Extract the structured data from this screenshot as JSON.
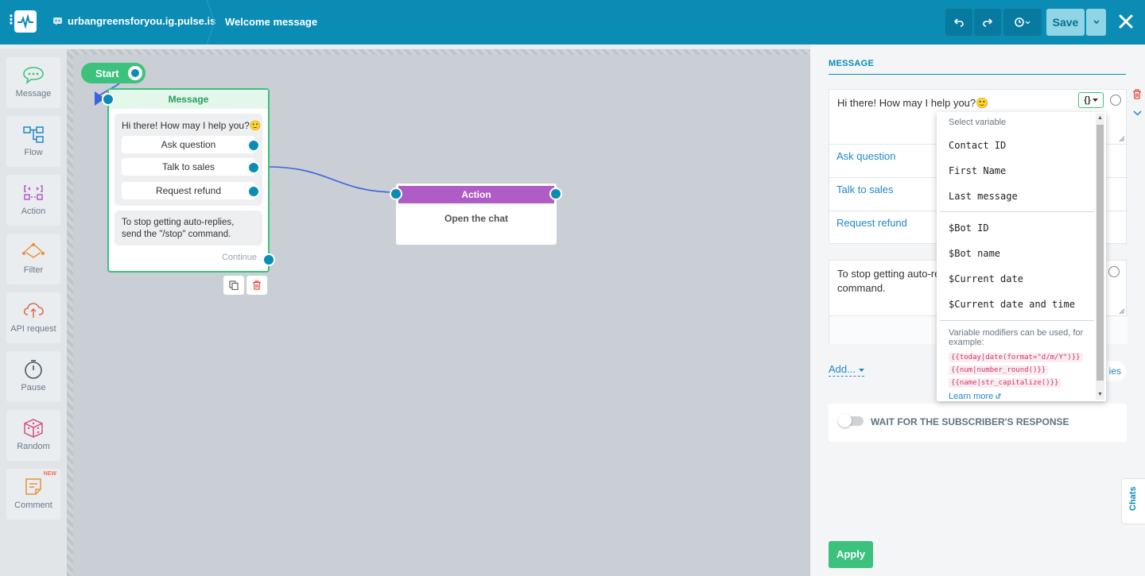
{
  "header": {
    "bot_name": "urbangreensforyou.ig.pulse.is",
    "page_title": "Welcome message",
    "save_label": "Save"
  },
  "sidebar": {
    "tools": [
      {
        "label": "Message",
        "icon": "chat-bubble-icon"
      },
      {
        "label": "Flow",
        "icon": "flow-icon"
      },
      {
        "label": "Action",
        "icon": "action-icon"
      },
      {
        "label": "Filter",
        "icon": "filter-icon"
      },
      {
        "label": "API request",
        "icon": "api-request-icon"
      },
      {
        "label": "Pause",
        "icon": "timer-icon"
      },
      {
        "label": "Random",
        "icon": "dice-icon"
      },
      {
        "label": "Comment",
        "icon": "comment-icon",
        "badge": "NEW"
      }
    ]
  },
  "canvas": {
    "start_label": "Start",
    "message_node": {
      "title": "Message",
      "text": "Hi there! How may I help you?🙂",
      "buttons": [
        "Ask question",
        "Talk to sales",
        "Request refund"
      ],
      "text2": "To stop getting auto-replies, send the \"/stop\" command.",
      "continue_label": "Continue"
    },
    "action_node": {
      "title": "Action",
      "body": "Open the chat"
    }
  },
  "panel": {
    "title": "MESSAGE",
    "message_text": "Hi there! How may I help you?🙂",
    "buttons": [
      "Ask question",
      "Talk to sales",
      "Request refund"
    ],
    "message2_text_line1": "To stop getting auto-re",
    "message2_text_line2": "command.",
    "add_label": "Add...",
    "replies_label": "ies",
    "wait_label": "WAIT FOR THE SUBSCRIBER'S RESPONSE",
    "apply_label": "Apply",
    "chats_label": "Chats",
    "var_button_label": "{}"
  },
  "variable_dropdown": {
    "header": "Select variable",
    "contact_vars": [
      "Contact ID",
      "First Name",
      "Last message"
    ],
    "system_vars": [
      "$Bot ID",
      "$Bot name",
      "$Current date",
      "$Current date and time"
    ],
    "note": "Variable modifiers can be used, for example:",
    "examples": [
      "{{today|date(format=\"d/m/Y\")}}",
      "{{num|number_round()}}",
      "{{name|str_capitalize()}}"
    ],
    "learn_more": "Learn more"
  },
  "colors": {
    "header_bg": "#0a8cb5",
    "green": "#3cc27d",
    "action_purple": "#b05cc6",
    "link_blue": "#1f88c9",
    "danger": "#e74c3c"
  }
}
